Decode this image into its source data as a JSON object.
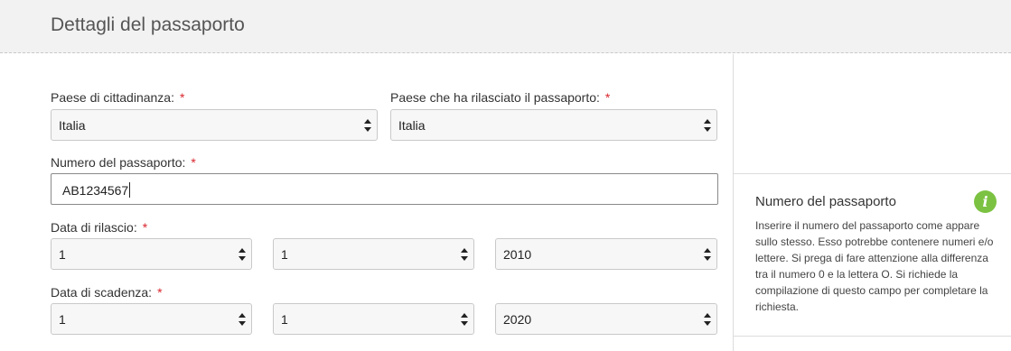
{
  "header": {
    "title": "Dettagli del passaporto"
  },
  "form": {
    "required_marker": "*",
    "citizenship": {
      "label": "Paese di cittadinanza:",
      "value": "Italia"
    },
    "issuing_country": {
      "label": "Paese che ha rilasciato il passaporto:",
      "value": "Italia"
    },
    "passport_number": {
      "label": "Numero del passaporto:",
      "value": "AB1234567"
    },
    "issue_date": {
      "label": "Data di rilascio:",
      "day": "1",
      "month": "1",
      "year": "2010"
    },
    "expiry_date": {
      "label": "Data di scadenza:",
      "day": "1",
      "month": "1",
      "year": "2020"
    }
  },
  "help": {
    "title": "Numero del passaporto",
    "icon": "info-icon",
    "icon_color": "#7cc242",
    "text": "Inserire il numero del passaporto come appare sullo stesso. Esso potrebbe contenere numeri e/o lettere. Si prega di fare attenzione alla differenza tra il numero 0 e la lettera O. Si richiede la compilazione di questo campo per completare la richiesta."
  }
}
